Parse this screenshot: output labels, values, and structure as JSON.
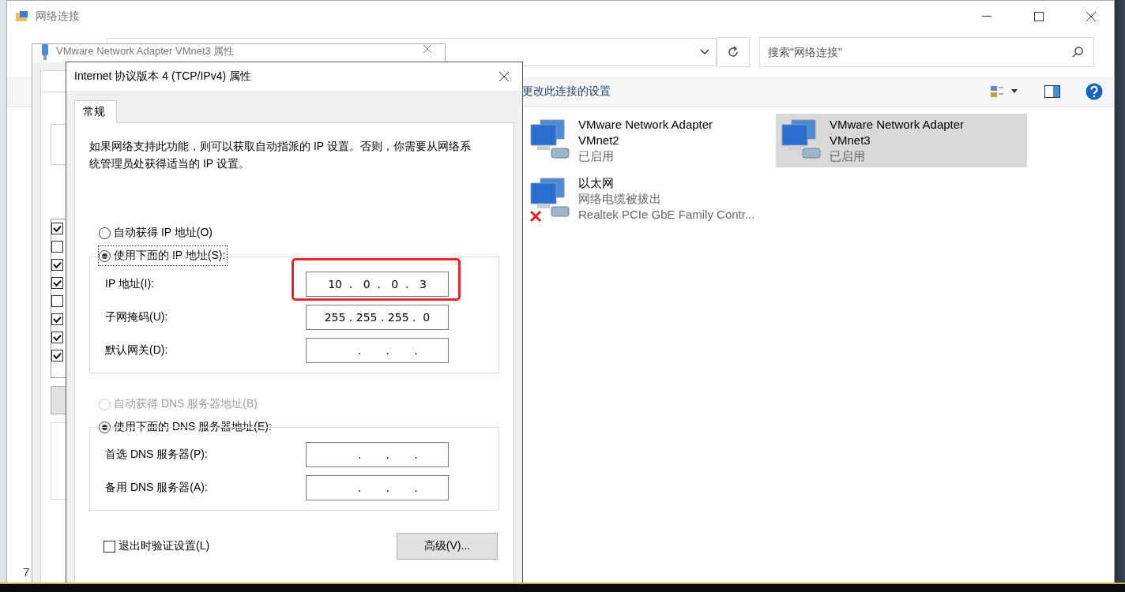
{
  "explorer": {
    "title": "网络连接",
    "search": {
      "placeholder": "搜索\"网络连接\""
    },
    "command_bar": {
      "action": "更改此连接的设置"
    },
    "connections": [
      {
        "name": "VMware Network Adapter VMnet2",
        "status": "已启用",
        "selected": false,
        "unplugged": false
      },
      {
        "name": "VMware Network Adapter VMnet3",
        "status": "已启用",
        "selected": true,
        "unplugged": false
      },
      {
        "name": "以太网",
        "status": "网络电缆被拔出",
        "device": "Realtek PCIe GbE Family Contr...",
        "selected": false,
        "unplugged": true
      }
    ],
    "status_bar": "7"
  },
  "adapter_window": {
    "title": "VMware Network Adapter VMnet3 属性",
    "components": [
      {
        "checked": true
      },
      {
        "checked": false
      },
      {
        "checked": true
      },
      {
        "checked": true
      },
      {
        "checked": false
      },
      {
        "checked": true
      },
      {
        "checked": true
      },
      {
        "checked": true
      }
    ]
  },
  "dialog": {
    "title": "Internet 协议版本 4 (TCP/IPv4) 属性",
    "tabs": [
      {
        "label": "常规",
        "selected": true
      }
    ],
    "description": "如果网络支持此功能，则可以获取自动指派的 IP 设置。否则，你需要从网络系统管理员处获得适当的 IP 设置。",
    "ip_options": [
      {
        "label": "自动获得 IP 地址(O)",
        "selected": false,
        "disabled": false
      },
      {
        "label": "使用下面的 IP 地址(S):",
        "selected": true,
        "disabled": false
      }
    ],
    "ip_fields": [
      {
        "label": "IP 地址(I):",
        "value": "10  .   0  .   0  .   3",
        "highlighted": true
      },
      {
        "label": "子网掩码(U):",
        "value": "255 . 255 . 255 .  0",
        "highlighted": false
      },
      {
        "label": "默认网关(D):",
        "value": "      .       .       .",
        "highlighted": false
      }
    ],
    "dns_options": [
      {
        "label": "自动获得 DNS 服务器地址(B)",
        "selected": false,
        "disabled": true
      },
      {
        "label": "使用下面的 DNS 服务器地址(E):",
        "selected": true,
        "disabled": false
      }
    ],
    "dns_fields": [
      {
        "label": "首选 DNS 服务器(P):",
        "value": "      .       .       .",
        "highlighted": false
      },
      {
        "label": "备用 DNS 服务器(A):",
        "value": "      .       .       .",
        "highlighted": false
      }
    ],
    "validate_on_exit": {
      "label": "退出时验证设置(L)",
      "checked": false
    },
    "advanced_button": "高级(V)..."
  }
}
